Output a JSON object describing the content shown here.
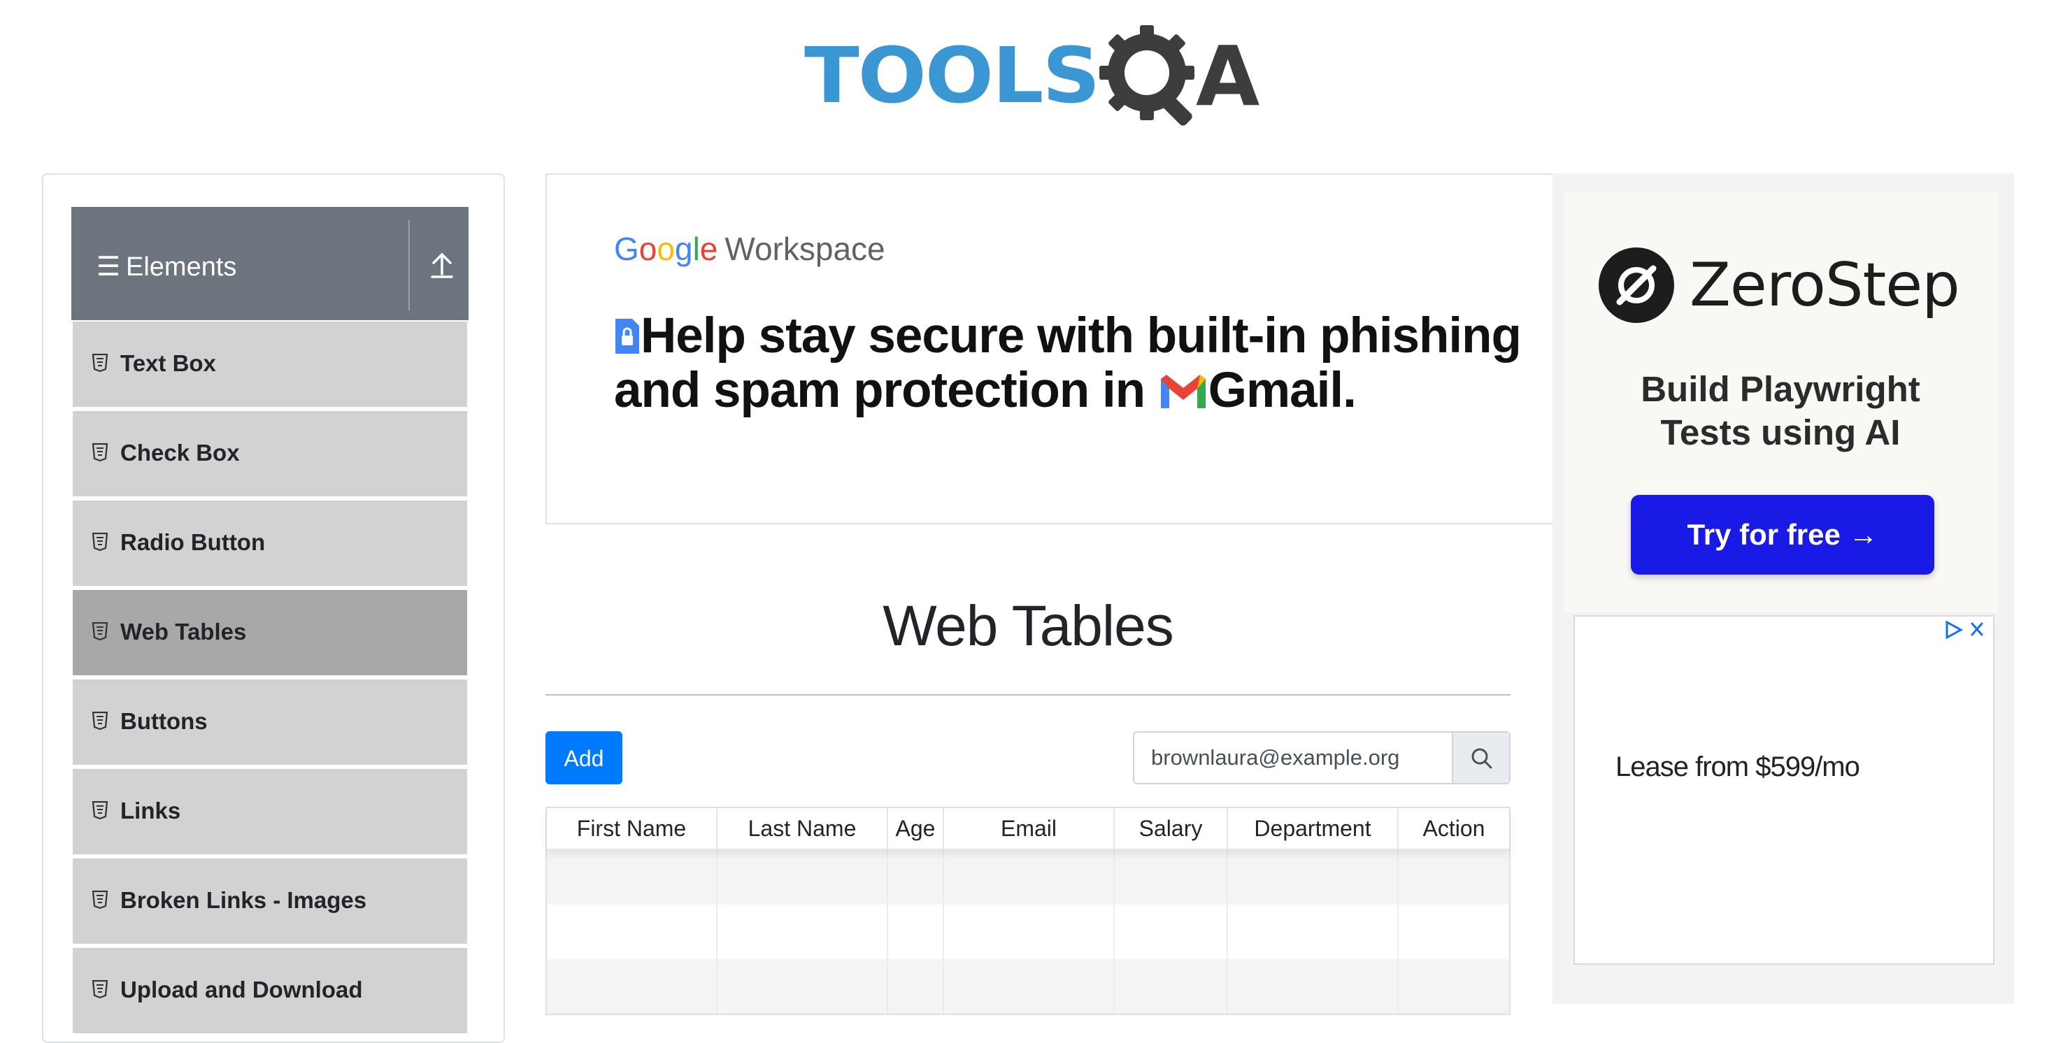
{
  "header": {
    "logo_tools": "TOOLS",
    "logo_a": "A"
  },
  "sidebar": {
    "group_title": "Elements",
    "items": [
      {
        "label": "Text Box",
        "active": false
      },
      {
        "label": "Check Box",
        "active": false
      },
      {
        "label": "Radio Button",
        "active": false
      },
      {
        "label": "Web Tables",
        "active": true
      },
      {
        "label": "Buttons",
        "active": false
      },
      {
        "label": "Links",
        "active": false
      },
      {
        "label": "Broken Links - Images",
        "active": false
      },
      {
        "label": "Upload and Download",
        "active": false
      }
    ]
  },
  "ad_banner": {
    "brand_letters": [
      "G",
      "o",
      "o",
      "g",
      "l",
      "e"
    ],
    "brand_product": "Workspace",
    "headline_part1": "Help stay secure with built-in phishing and spam protection in ",
    "headline_part2": "Gmail."
  },
  "main": {
    "title": "Web Tables",
    "add_label": "Add",
    "search": {
      "value": "brownlaura@example.org",
      "placeholder": "Type to search"
    },
    "table": {
      "columns": [
        "First Name",
        "Last Name",
        "Age",
        "Email",
        "Salary",
        "Department",
        "Action"
      ],
      "rows": [
        [
          "",
          "",
          "",
          "",
          "",
          "",
          ""
        ],
        [
          "",
          "",
          "",
          "",
          "",
          "",
          ""
        ],
        [
          "",
          "",
          "",
          "",
          "",
          "",
          ""
        ]
      ]
    }
  },
  "right_ads": {
    "zerostep": {
      "name": "ZeroStep",
      "tagline_line1": "Build Playwright",
      "tagline_line2": "Tests using AI",
      "cta": "Try for free →"
    },
    "lease": {
      "text": "Lease from $599/mo"
    }
  },
  "colors": {
    "primary_button": "#007bff",
    "sidebar_header": "#6c757d",
    "sidebar_item": "#d2d2d2",
    "sidebar_item_active": "#a8a8a8",
    "zerostep_cta": "#1a1ae6",
    "logo_blue": "#3b97d3"
  }
}
